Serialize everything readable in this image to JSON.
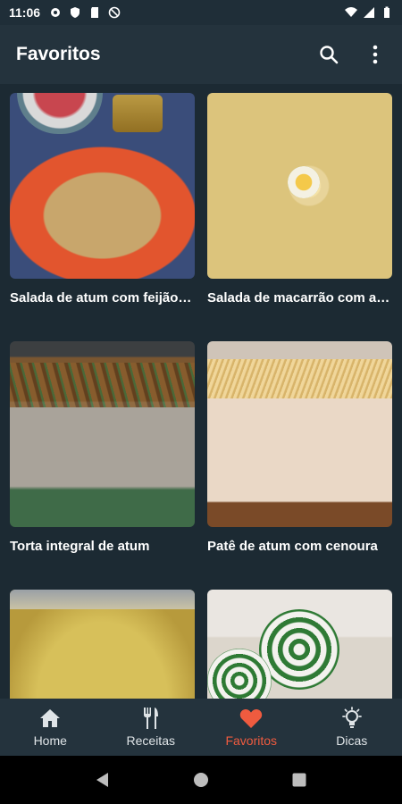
{
  "status": {
    "time": "11:06"
  },
  "appbar": {
    "title": "Favoritos"
  },
  "recipes": [
    {
      "title": "Salada de atum com feijão fradinho"
    },
    {
      "title": "Salada de macarrão com atum"
    },
    {
      "title": "Torta integral de atum"
    },
    {
      "title": "Patê de atum com cenoura"
    },
    {
      "title": ""
    },
    {
      "title": ""
    }
  ],
  "nav": {
    "items": [
      {
        "label": "Home",
        "icon": "home-icon"
      },
      {
        "label": "Receitas",
        "icon": "fork-knife-icon"
      },
      {
        "label": "Favoritos",
        "icon": "heart-icon"
      },
      {
        "label": "Dicas",
        "icon": "lightbulb-icon"
      }
    ],
    "active": "Favoritos"
  },
  "colors": {
    "accent": "#ef5b3f",
    "appbar": "#24333d",
    "background": "#1c2a33"
  }
}
